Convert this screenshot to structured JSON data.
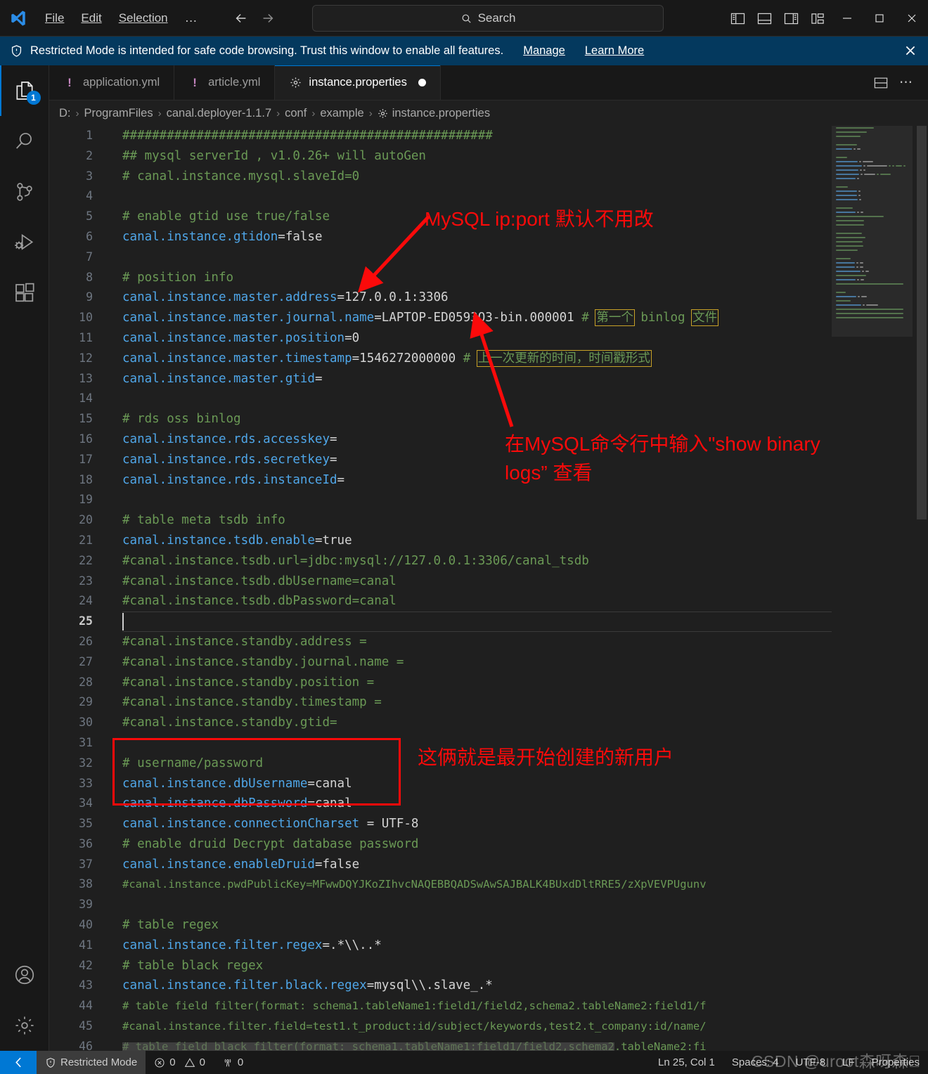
{
  "titlebar": {
    "menus": [
      {
        "label": "File",
        "accel": "F"
      },
      {
        "label": "Edit",
        "accel": "E"
      },
      {
        "label": "Selection",
        "accel": "S"
      }
    ],
    "overflow_label": "…",
    "back_label": "Go Back",
    "forward_label": "Go Forward",
    "search_placeholder": "Search",
    "layout_buttons": [
      "toggle-primary-sidebar",
      "toggle-panel",
      "toggle-secondary-sidebar",
      "customize-layout"
    ],
    "window_buttons": [
      "minimize",
      "maximize",
      "close"
    ]
  },
  "banner": {
    "text": "Restricted Mode is intended for safe code browsing. Trust this window to enable all features.",
    "manage_label": "Manage",
    "learn_more_label": "Learn More",
    "background": "#04395e"
  },
  "activitybar": {
    "items": [
      {
        "name": "explorer",
        "icon": "files-icon",
        "badge": "1",
        "active": true
      },
      {
        "name": "search",
        "icon": "search-icon",
        "badge": "",
        "active": false
      },
      {
        "name": "source-control",
        "icon": "source-control-icon",
        "badge": "",
        "active": false
      },
      {
        "name": "run-and-debug",
        "icon": "run-debug-icon",
        "badge": "",
        "active": false
      },
      {
        "name": "extensions",
        "icon": "extensions-icon",
        "badge": "",
        "active": false
      }
    ],
    "bottom": [
      {
        "name": "accounts",
        "icon": "account-icon"
      },
      {
        "name": "settings",
        "icon": "gear-icon"
      }
    ]
  },
  "tabs": [
    {
      "label": "application.yml",
      "icon": "yaml-icon",
      "active": false,
      "dirty": false
    },
    {
      "label": "article.yml",
      "icon": "yaml-icon",
      "active": false,
      "dirty": false
    },
    {
      "label": "instance.properties",
      "icon": "properties-gear-icon",
      "active": true,
      "dirty": true
    }
  ],
  "tabs_actions": {
    "split_editor": "split-editor-icon",
    "more_actions": "⋯"
  },
  "breadcrumb": [
    "D:",
    "ProgramFiles",
    "canal.deployer-1.1.7",
    "conf",
    "example",
    "instance.properties"
  ],
  "editor": {
    "active_line": 25,
    "lines": [
      {
        "n": 1,
        "segments": [
          {
            "t": "cmt",
            "s": "##################################################"
          }
        ]
      },
      {
        "n": 2,
        "segments": [
          {
            "t": "cmt",
            "s": "## mysql serverId , v1.0.26+ will autoGen"
          }
        ]
      },
      {
        "n": 3,
        "segments": [
          {
            "t": "cmt",
            "s": "# canal.instance.mysql.slaveId=0"
          }
        ]
      },
      {
        "n": 4,
        "segments": []
      },
      {
        "n": 5,
        "segments": [
          {
            "t": "cmt",
            "s": "# enable gtid use true/false"
          }
        ]
      },
      {
        "n": 6,
        "segments": [
          {
            "t": "key",
            "s": "canal.instance.gtidon"
          },
          {
            "t": "eq",
            "s": "="
          },
          {
            "t": "val",
            "s": "false"
          }
        ]
      },
      {
        "n": 7,
        "segments": []
      },
      {
        "n": 8,
        "segments": [
          {
            "t": "cmt",
            "s": "# position info"
          }
        ]
      },
      {
        "n": 9,
        "segments": [
          {
            "t": "key",
            "s": "canal.instance.master.address"
          },
          {
            "t": "eq",
            "s": "="
          },
          {
            "t": "val",
            "s": "127.0.0.1:3306"
          }
        ]
      },
      {
        "n": 10,
        "segments": [
          {
            "t": "key",
            "s": "canal.instance.master.journal.name"
          },
          {
            "t": "eq",
            "s": "="
          },
          {
            "t": "val",
            "s": "LAPTOP-ED0593Q3-bin.000001 "
          },
          {
            "t": "cmt",
            "s": "# "
          },
          {
            "t": "cmt-box",
            "s": "第一个"
          },
          {
            "t": "cmt",
            "s": " binlog "
          },
          {
            "t": "cmt-box",
            "s": "文件"
          }
        ]
      },
      {
        "n": 11,
        "segments": [
          {
            "t": "key",
            "s": "canal.instance.master.position"
          },
          {
            "t": "eq",
            "s": "="
          },
          {
            "t": "val",
            "s": "0"
          }
        ]
      },
      {
        "n": 12,
        "segments": [
          {
            "t": "key",
            "s": "canal.instance.master.timestamp"
          },
          {
            "t": "eq",
            "s": "="
          },
          {
            "t": "val",
            "s": "1546272000000 "
          },
          {
            "t": "cmt",
            "s": "# "
          },
          {
            "t": "cmt-box",
            "s": "上一次更新的时间，时间戳形式"
          }
        ]
      },
      {
        "n": 13,
        "segments": [
          {
            "t": "key",
            "s": "canal.instance.master.gtid"
          },
          {
            "t": "eq",
            "s": "="
          }
        ]
      },
      {
        "n": 14,
        "segments": []
      },
      {
        "n": 15,
        "segments": [
          {
            "t": "cmt",
            "s": "# rds oss binlog"
          }
        ]
      },
      {
        "n": 16,
        "segments": [
          {
            "t": "key",
            "s": "canal.instance.rds.accesskey"
          },
          {
            "t": "eq",
            "s": "="
          }
        ]
      },
      {
        "n": 17,
        "segments": [
          {
            "t": "key",
            "s": "canal.instance.rds.secretkey"
          },
          {
            "t": "eq",
            "s": "="
          }
        ]
      },
      {
        "n": 18,
        "segments": [
          {
            "t": "key",
            "s": "canal.instance.rds.instanceId"
          },
          {
            "t": "eq",
            "s": "="
          }
        ]
      },
      {
        "n": 19,
        "segments": []
      },
      {
        "n": 20,
        "segments": [
          {
            "t": "cmt",
            "s": "# table meta tsdb info"
          }
        ]
      },
      {
        "n": 21,
        "segments": [
          {
            "t": "key",
            "s": "canal.instance.tsdb.enable"
          },
          {
            "t": "eq",
            "s": "="
          },
          {
            "t": "val",
            "s": "true"
          }
        ]
      },
      {
        "n": 22,
        "segments": [
          {
            "t": "cmt",
            "s": "#canal.instance.tsdb.url=jdbc:mysql://127.0.0.1:3306/canal_tsdb"
          }
        ]
      },
      {
        "n": 23,
        "segments": [
          {
            "t": "cmt",
            "s": "#canal.instance.tsdb.dbUsername=canal"
          }
        ]
      },
      {
        "n": 24,
        "segments": [
          {
            "t": "cmt",
            "s": "#canal.instance.tsdb.dbPassword=canal"
          }
        ]
      },
      {
        "n": 25,
        "segments": []
      },
      {
        "n": 26,
        "segments": [
          {
            "t": "cmt",
            "s": "#canal.instance.standby.address = "
          }
        ]
      },
      {
        "n": 27,
        "segments": [
          {
            "t": "cmt",
            "s": "#canal.instance.standby.journal.name = "
          }
        ]
      },
      {
        "n": 28,
        "segments": [
          {
            "t": "cmt",
            "s": "#canal.instance.standby.position = "
          }
        ]
      },
      {
        "n": 29,
        "segments": [
          {
            "t": "cmt",
            "s": "#canal.instance.standby.timestamp = "
          }
        ]
      },
      {
        "n": 30,
        "segments": [
          {
            "t": "cmt",
            "s": "#canal.instance.standby.gtid="
          }
        ]
      },
      {
        "n": 31,
        "segments": []
      },
      {
        "n": 32,
        "segments": [
          {
            "t": "cmt",
            "s": "# username/password"
          }
        ]
      },
      {
        "n": 33,
        "segments": [
          {
            "t": "key",
            "s": "canal.instance.dbUsername"
          },
          {
            "t": "eq",
            "s": "="
          },
          {
            "t": "val",
            "s": "canal"
          }
        ]
      },
      {
        "n": 34,
        "segments": [
          {
            "t": "key",
            "s": "canal.instance.dbPassword"
          },
          {
            "t": "eq",
            "s": "="
          },
          {
            "t": "val",
            "s": "canal"
          }
        ]
      },
      {
        "n": 35,
        "segments": [
          {
            "t": "key",
            "s": "canal.instance.connectionCharset"
          },
          {
            "t": "eq",
            "s": " = "
          },
          {
            "t": "val",
            "s": "UTF-8"
          }
        ]
      },
      {
        "n": 36,
        "segments": [
          {
            "t": "cmt",
            "s": "# enable druid Decrypt database password"
          }
        ]
      },
      {
        "n": 37,
        "segments": [
          {
            "t": "key",
            "s": "canal.instance.enableDruid"
          },
          {
            "t": "eq",
            "s": "="
          },
          {
            "t": "val",
            "s": "false"
          }
        ]
      },
      {
        "n": 38,
        "segments": [
          {
            "t": "cmt-sm",
            "s": "#canal.instance.pwdPublicKey=MFwwDQYJKoZIhvcNAQEBBQADSwAwSAJBALK4BUxdDltRRE5/zXpVEVPUgunv"
          }
        ]
      },
      {
        "n": 39,
        "segments": []
      },
      {
        "n": 40,
        "segments": [
          {
            "t": "cmt",
            "s": "# table regex"
          }
        ]
      },
      {
        "n": 41,
        "segments": [
          {
            "t": "key",
            "s": "canal.instance.filter.regex"
          },
          {
            "t": "eq",
            "s": "="
          },
          {
            "t": "val",
            "s": ".*\\\\..*"
          }
        ]
      },
      {
        "n": 42,
        "segments": [
          {
            "t": "cmt",
            "s": "# table black regex"
          }
        ]
      },
      {
        "n": 43,
        "segments": [
          {
            "t": "key",
            "s": "canal.instance.filter.black.regex"
          },
          {
            "t": "eq",
            "s": "="
          },
          {
            "t": "val",
            "s": "mysql\\\\.slave_.*"
          }
        ]
      },
      {
        "n": 44,
        "segments": [
          {
            "t": "cmt-sm",
            "s": "# table field filter(format: schema1.tableName1:field1/field2,schema2.tableName2:field1/f"
          }
        ]
      },
      {
        "n": 45,
        "segments": [
          {
            "t": "cmt-sm",
            "s": "#canal.instance.filter.field=test1.t_product:id/subject/keywords,test2.t_company:id/name/"
          }
        ]
      },
      {
        "n": 46,
        "segments": [
          {
            "t": "cmt-sm",
            "s": "# table field black filter(format: schema1.tableName1:field1/field2,schema2.tableName2:fi"
          }
        ]
      }
    ]
  },
  "annotations": [
    {
      "name": "annotation-mysql-ip-port",
      "text": "MySQL ip:port 默认不用改",
      "color": "#fb0a0a"
    },
    {
      "name": "annotation-show-binary-logs",
      "text": "在MySQL命令行中输入\"show binary\nlogs” 查看",
      "color": "#fb0a0a"
    },
    {
      "name": "annotation-new-user",
      "text": "这俩就是最开始创建的新用户",
      "color": "#fb0a0a"
    }
  ],
  "statusbar": {
    "remote_icon": "remote-window-icon",
    "trust_label": "Restricted Mode",
    "errors": "0",
    "warnings": "0",
    "ports": "0",
    "cursor_position": "Ln 25, Col 1",
    "indentation": "Spaces: 4",
    "encoding": "UTF-8",
    "eol": "LF",
    "language": "Properties"
  },
  "watermark": {
    "text": "CSDN @uroot森呀森"
  }
}
